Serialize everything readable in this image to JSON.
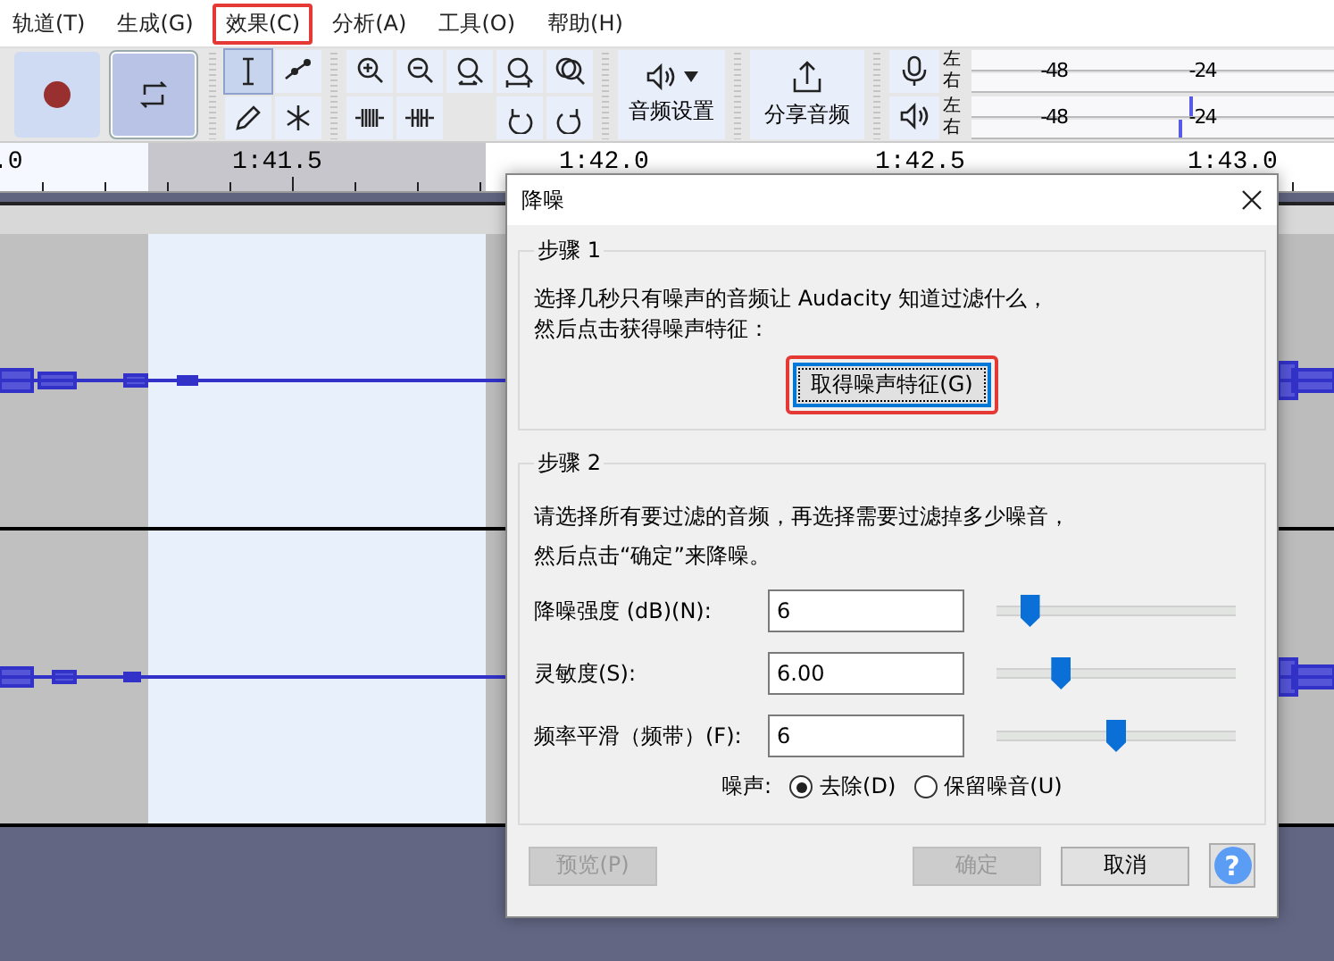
{
  "menu": [
    {
      "label": "轨道(T)",
      "highlighted": false
    },
    {
      "label": "生成(G)",
      "highlighted": false
    },
    {
      "label": "效果(C)",
      "highlighted": true
    },
    {
      "label": "分析(A)",
      "highlighted": false
    },
    {
      "label": "工具(O)",
      "highlighted": false
    },
    {
      "label": "帮助(H)",
      "highlighted": false
    }
  ],
  "toolbar": {
    "tools": [
      {
        "kind": "ibeam",
        "selected": true
      },
      {
        "kind": "envelope",
        "selected": false
      },
      {
        "kind": "pencil",
        "selected": false
      },
      {
        "kind": "multi",
        "selected": false
      }
    ],
    "audio_setup": {
      "label": "音频设置"
    },
    "share_audio": {
      "label": "分享音频"
    },
    "meters": [
      {
        "kind": "recording",
        "ticks": [
          "-48",
          "-24"
        ],
        "channels": [
          {
            "label": "左"
          },
          {
            "label": "右"
          }
        ]
      },
      {
        "kind": "playback",
        "ticks": [
          "-48",
          "-24"
        ],
        "channels": [
          {
            "label": "左",
            "level": 0.6
          },
          {
            "label": "右",
            "level": 0.57
          }
        ]
      }
    ]
  },
  "ruler": {
    "labels": [
      ".0",
      "1:41.5",
      "1:42.0",
      "1:42.5",
      "1:43.0"
    ]
  },
  "dialog": {
    "title": "降噪",
    "step1": {
      "heading": "步骤 1",
      "lines": [
        "选择几秒只有噪声的音频让 Audacity 知道过滤什么，",
        "然后点击获得噪声特征："
      ],
      "button": {
        "label": "取得噪声特征(G)",
        "highlighted": true
      }
    },
    "step2": {
      "heading": "步骤 2",
      "lines": [
        "请选择所有要过滤的音频，再选择需要过滤掉多少噪音，",
        "然后点击“确定”来降噪。"
      ],
      "fields": [
        {
          "label": "降噪强度 (dB)(N):",
          "value": "6",
          "level": 0.14
        },
        {
          "label": "灵敏度(S):",
          "value": "6.00",
          "level": 0.27
        },
        {
          "label": "频率平滑（频带）(F):",
          "value": "6",
          "level": 0.5
        }
      ],
      "noise": {
        "label": "噪声:",
        "options": [
          {
            "label": "去除(D)",
            "selected": true
          },
          {
            "label": "保留噪音(U)",
            "selected": false
          }
        ]
      }
    },
    "buttons": [
      {
        "kind": "preview",
        "label": "预览(P)",
        "disabled": true
      },
      {
        "kind": "ok",
        "label": "确定",
        "disabled": true
      },
      {
        "kind": "cancel",
        "label": "取消",
        "disabled": false
      },
      {
        "kind": "help",
        "label": "?",
        "disabled": false
      }
    ]
  }
}
